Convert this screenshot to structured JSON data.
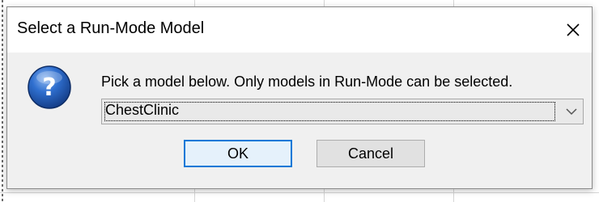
{
  "dialog": {
    "title": "Select a Run-Mode Model",
    "close_icon": "close-icon",
    "icon": "question-icon",
    "prompt": "Pick a model below. Only models in Run-Mode can be selected.",
    "select": {
      "value": "ChestClinic",
      "arrow_icon": "chevron-down-icon"
    },
    "buttons": {
      "ok_label": "OK",
      "cancel_label": "Cancel"
    }
  },
  "colors": {
    "dialog_body": "#f0f0f0",
    "titlebar": "#ffffff",
    "default_button_border": "#0078d7",
    "default_button_fill": "#e5f1fb",
    "icon_blue": "#1f5fb8"
  }
}
